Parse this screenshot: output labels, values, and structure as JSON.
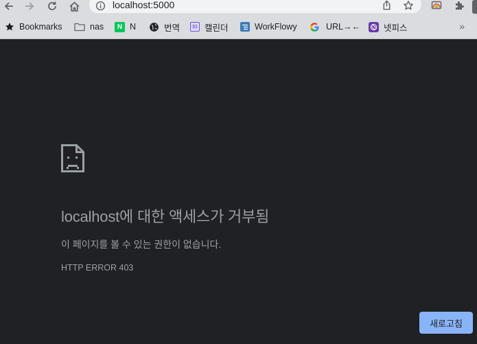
{
  "address_bar": {
    "url": "localhost:5000"
  },
  "bookmarks": [
    {
      "label": "Bookmarks",
      "icon": "star-icon"
    },
    {
      "label": "nas",
      "icon": "folder-icon"
    },
    {
      "label": "N",
      "icon": "naver-icon",
      "icon_text": "N",
      "color": "#03c75a"
    },
    {
      "label": "번역",
      "icon": "globe-icon"
    },
    {
      "label": "캘린더",
      "icon": "calendar-icon",
      "icon_text": "31",
      "color": "#7c4dff"
    },
    {
      "label": "WorkFlowy",
      "icon": "workflowy-icon",
      "color": "#3c7ab8"
    },
    {
      "label": "URL→←",
      "icon": "google-icon"
    },
    {
      "label": "넷피스",
      "icon": "netpis-icon",
      "color": "#6a3aa8"
    }
  ],
  "bookmarks_more": "»",
  "error": {
    "title": "localhost에 대한 액세스가 거부됨",
    "message": "이 페이지를 볼 수 있는 권한이 없습니다.",
    "code": "HTTP ERROR 403",
    "reload_label": "새로고침"
  },
  "colors": {
    "page_bg": "#202124",
    "text": "#9aa0a6",
    "button": "#8ab4f8",
    "chrome": "#dadce0"
  }
}
